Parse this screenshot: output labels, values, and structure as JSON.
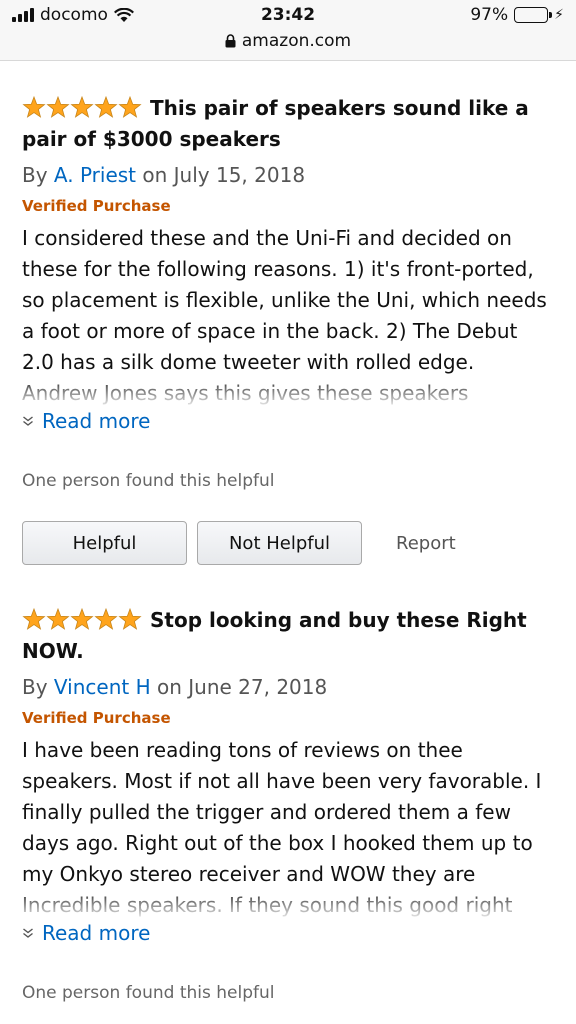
{
  "status_bar": {
    "carrier": "docomo",
    "time": "23:42",
    "url": "amazon.com",
    "battery": "97%",
    "battery_level": 0.97
  },
  "reviews": [
    {
      "rating": 5,
      "title": "This pair of speakers sound like a pair of $3000 speakers",
      "by": "By",
      "author": "A. Priest",
      "date": "on July 15, 2018",
      "verified": "Verified Purchase",
      "body": "I considered these and the Uni-Fi and decided on these for the following reasons. 1) it's front-ported, so placement is flexible, unlike the Uni, which needs a foot or more of space in the back. 2) The Debut 2.0 has a silk dome tweeter with rolled edge. Andrew Jones says this gives these speakers",
      "read_more": "Read more",
      "helpful_text": "One person found this helpful",
      "helpful_button": "Helpful",
      "not_helpful_button": "Not Helpful",
      "report": "Report"
    },
    {
      "rating": 5,
      "title": "Stop looking and buy these Right NOW.",
      "by": "By",
      "author": "Vincent H",
      "date": "on June 27, 2018",
      "verified": "Verified Purchase",
      "body": "I have been reading tons of reviews on thee speakers. Most if not all have been very favorable. I finally pulled the trigger and ordered them a few days ago. Right out of the box I hooked them up to my Onkyo stereo receiver and WOW they are Incredible speakers. If they sound this good right",
      "read_more": "Read more",
      "helpful_text": "One person found this helpful"
    }
  ],
  "colors": {
    "link": "#0066c0",
    "verified": "#c45500",
    "star": "#ffa41c"
  }
}
